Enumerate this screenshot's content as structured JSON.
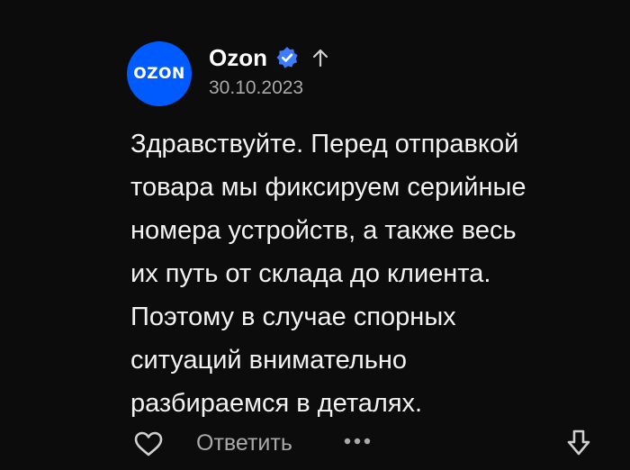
{
  "comment": {
    "avatar_text": "OZON",
    "author": "Ozon",
    "date": "30.10.2023",
    "text": "Здравствуйте. Перед отправкой\nтовара мы фиксируем серийные\nномера устройств, а также весь\nих путь от склада до клиента.\nПоэтому в случае спорных\nситуаций внимательно\nразбираемся в деталях.",
    "reply_label": "Ответить"
  },
  "icons": {
    "verified": "verified-check-icon",
    "up": "arrow-up-icon",
    "like": "heart-icon",
    "more": "more-dots-icon",
    "download": "arrow-down-icon"
  },
  "colors": {
    "background": "#0c0c0d",
    "avatar": "#005bff",
    "verified": "#3d7cff",
    "muted": "#a9a9a9"
  }
}
